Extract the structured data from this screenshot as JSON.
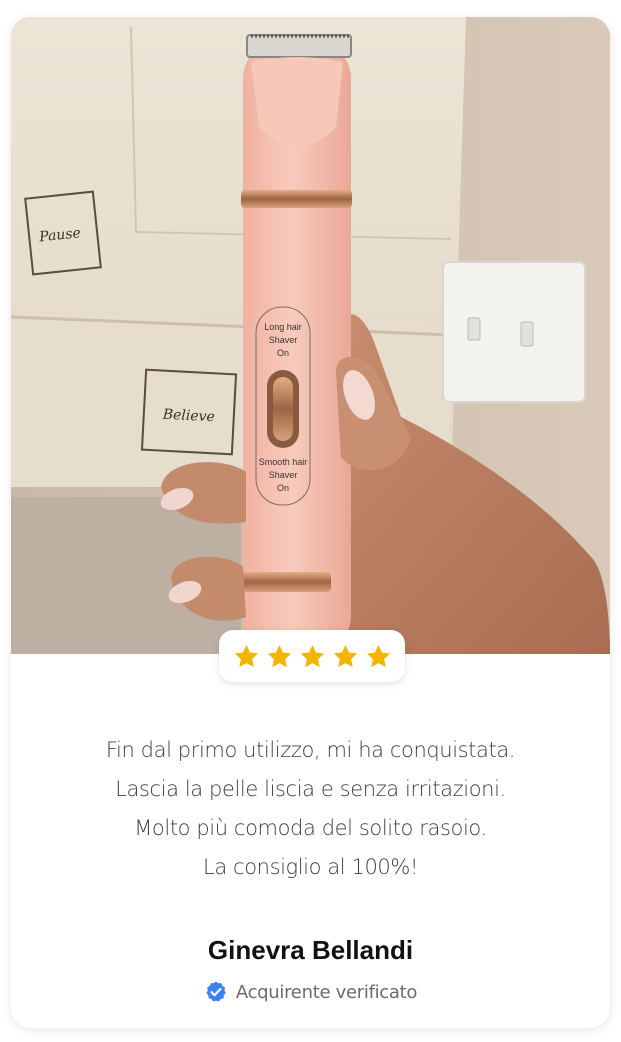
{
  "review": {
    "rating": 5,
    "rating_max": 5,
    "text_lines": [
      "Fin dal primo utilizzo, mi ha conquistata.",
      "Lascia la pelle liscia e senza irritazioni.",
      "Molto più comoda del solito rasoio.",
      "La consiglio al 100%!"
    ],
    "author_name": "Ginevra Bellandi",
    "verified_label": "Acquirente verificato"
  },
  "photo": {
    "device_labels": {
      "top_line1": "Long hair",
      "top_line2": "Shaver",
      "top_line3": "On",
      "bottom_line1": "Smooth hair",
      "bottom_line2": "Shaver",
      "bottom_line3": "On"
    },
    "bag_text_1": "Pause",
    "bag_text_2": "Believe"
  },
  "colors": {
    "star": "#f4b400",
    "verified": "#3b82f6",
    "device_pink": "#f4c1b3",
    "device_gold": "#c4875f"
  }
}
